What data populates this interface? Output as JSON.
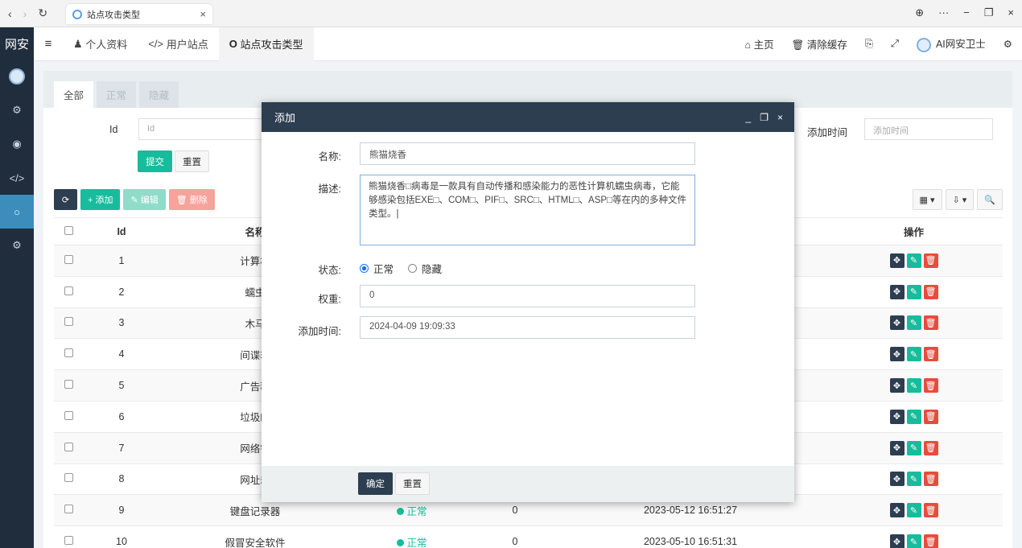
{
  "browser": {
    "tab_title": "站点攻击类型",
    "tab_close": "×",
    "back": "‹",
    "forward": "›",
    "reload": "↻",
    "window_controls": [
      "⊕",
      "···",
      "−",
      "❐",
      "×"
    ]
  },
  "sidebar": {
    "logo": "网安",
    "items": [
      {
        "icon": "avatar-icon"
      },
      {
        "icon": "gears-icon",
        "glyph": "⚙"
      },
      {
        "icon": "user-circle-icon",
        "glyph": "◉"
      },
      {
        "icon": "code-icon",
        "glyph": "</>"
      },
      {
        "icon": "circle-icon",
        "glyph": "○",
        "active": true
      },
      {
        "icon": "gears-icon",
        "glyph": "⚙"
      }
    ]
  },
  "topbar": {
    "menu_glyph": "≡",
    "nav": [
      {
        "label": "个人资料",
        "glyph": "♟"
      },
      {
        "label": "用户站点",
        "glyph": "</>"
      },
      {
        "label": "站点攻击类型",
        "glyph": "O",
        "active": true
      }
    ],
    "right": {
      "home": "主页",
      "clear_cache": "清除缓存",
      "user": "AI网安卫士",
      "translate_glyph": "⎘",
      "fullscreen_glyph": "⤢",
      "settings_glyph": "⚙"
    }
  },
  "panel": {
    "tabs": [
      {
        "label": "全部",
        "active": true
      },
      {
        "label": "正常"
      },
      {
        "label": "隐藏"
      }
    ],
    "search": {
      "id_label": "Id",
      "id_placeholder": "Id",
      "time_label": "添加时间",
      "time_placeholder": "添加时间",
      "submit": "提交",
      "reset": "重置"
    },
    "toolbar": {
      "refresh_glyph": "⟳",
      "add": "+ 添加",
      "edit": "✎ 编辑",
      "delete": "🗑 删除",
      "columns_glyph": "▦ ▾",
      "export_glyph": "⇩ ▾",
      "search_glyph": "🔍"
    }
  },
  "table": {
    "headers": [
      "",
      "Id",
      "名称",
      "",
      "",
      "",
      "操作"
    ],
    "rows": [
      {
        "id": "1",
        "name": "计算机",
        "status": "",
        "weight": "",
        "time": ""
      },
      {
        "id": "2",
        "name": "蠕虫",
        "status": "",
        "weight": "",
        "time": ""
      },
      {
        "id": "3",
        "name": "木马",
        "status": "",
        "weight": "",
        "time": ""
      },
      {
        "id": "4",
        "name": "间谍软",
        "status": "",
        "weight": "",
        "time": ""
      },
      {
        "id": "5",
        "name": "广告程",
        "status": "",
        "weight": "",
        "time": ""
      },
      {
        "id": "6",
        "name": "垃圾邮",
        "status": "",
        "weight": "",
        "time": ""
      },
      {
        "id": "7",
        "name": "网络钓",
        "status": "",
        "weight": "",
        "time": ""
      },
      {
        "id": "8",
        "name": "网址劫",
        "status": "",
        "weight": "",
        "time": ""
      },
      {
        "id": "9",
        "name": "键盘记录器",
        "status": "正常",
        "weight": "0",
        "time": "2023-05-12 16:51:27"
      },
      {
        "id": "10",
        "name": "假冒安全软件",
        "status": "正常",
        "weight": "0",
        "time": "2023-05-10 16:51:31"
      }
    ]
  },
  "modal": {
    "title": "添加",
    "controls": [
      "_",
      "❐",
      "×"
    ],
    "name_label": "名称:",
    "name_value": "熊猫烧香",
    "desc_label": "描述:",
    "desc_value": "熊猫烧香□病毒是一款具有自动传播和感染能力的恶性计算机蠕虫病毒，它能够感染包括EXE□、COM□、PIF□、SRC□、HTML□、ASP□等在内的多种文件类型。|",
    "status_label": "状态:",
    "status_normal": "正常",
    "status_hidden": "隐藏",
    "weight_label": "权重:",
    "weight_value": "0",
    "time_label": "添加时间:",
    "time_value": "2024-04-09 19:09:33",
    "ok": "确定",
    "reset": "重置"
  }
}
